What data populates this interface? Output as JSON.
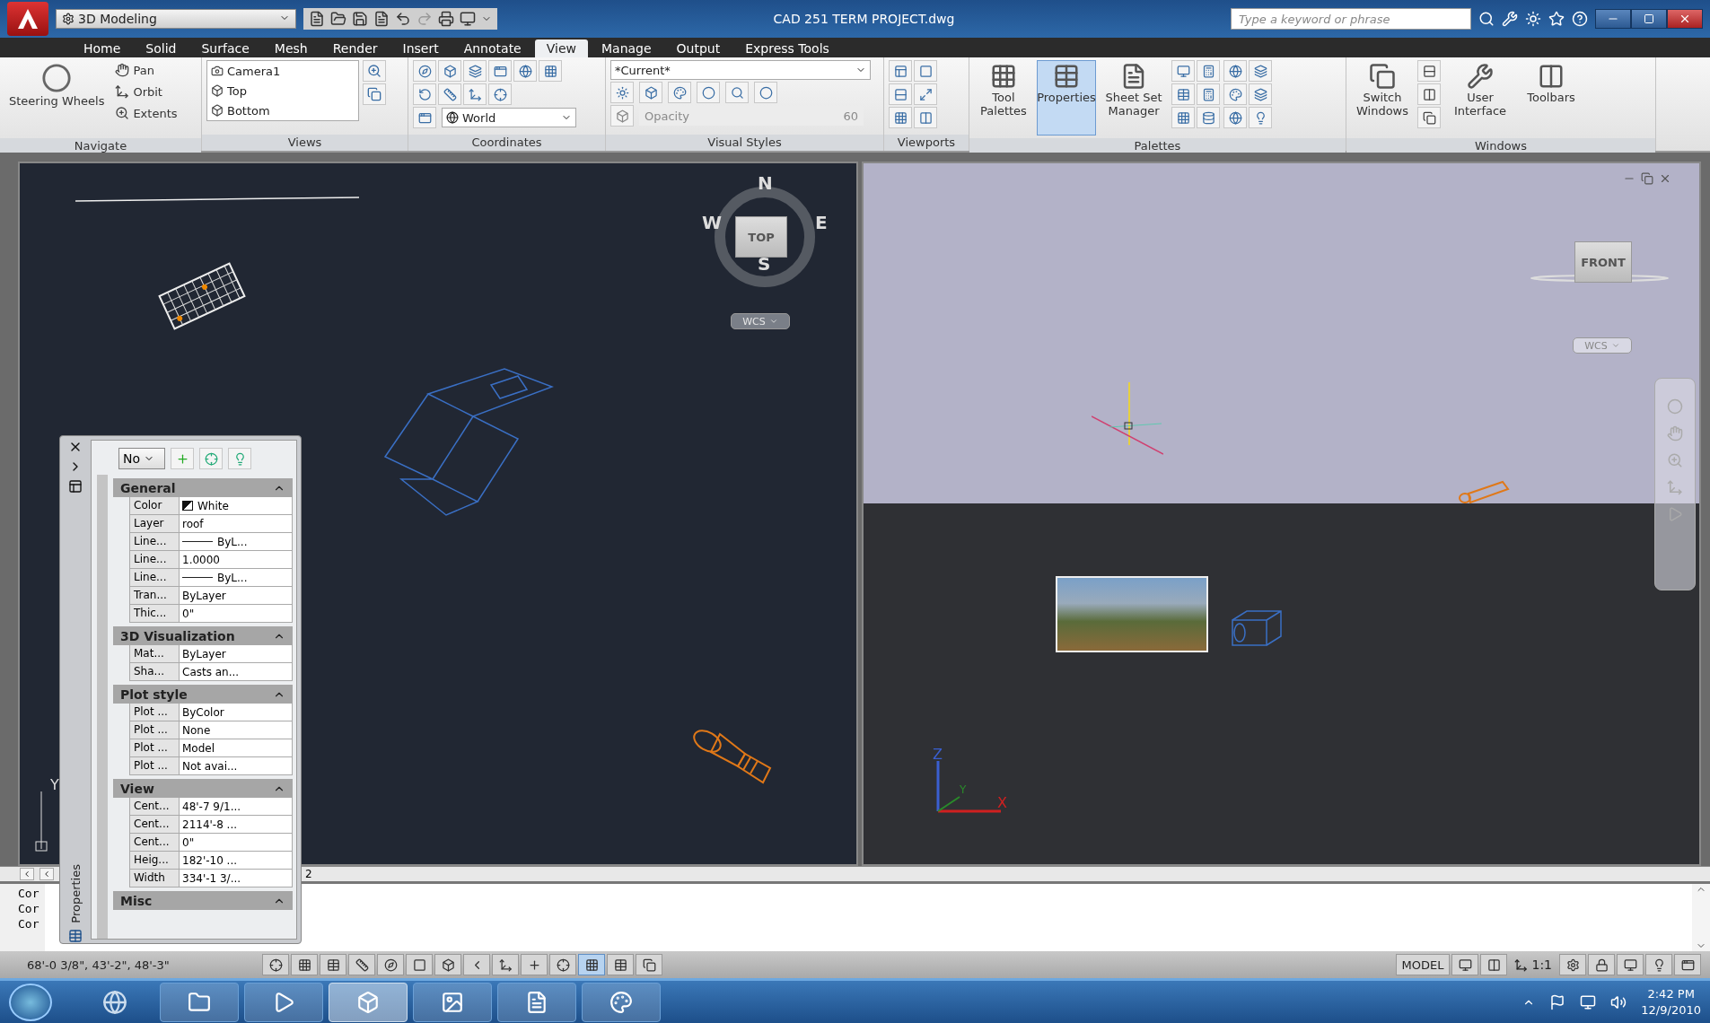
{
  "title_bar": {
    "workspace": "3D Modeling",
    "title": "CAD 251 TERM PROJECT.dwg",
    "search": {
      "placeholder": "Type a keyword or phrase"
    }
  },
  "ribbon_tabs": [
    {
      "label": "Home",
      "selected": false
    },
    {
      "label": "Solid",
      "selected": false
    },
    {
      "label": "Surface",
      "selected": false
    },
    {
      "label": "Mesh",
      "selected": false
    },
    {
      "label": "Render",
      "selected": false
    },
    {
      "label": "Insert",
      "selected": false
    },
    {
      "label": "Annotate",
      "selected": false
    },
    {
      "label": "View",
      "selected": true
    },
    {
      "label": "Manage",
      "selected": false
    },
    {
      "label": "Output",
      "selected": false
    },
    {
      "label": "Express Tools",
      "selected": false
    }
  ],
  "ribbon": {
    "navigate": {
      "title": "Navigate",
      "big": "Steering Wheels",
      "items": [
        "Pan",
        "Orbit",
        "Extents"
      ]
    },
    "views": {
      "title": "Views",
      "items": [
        "Camera1",
        "Top",
        "Bottom"
      ]
    },
    "coordinates": {
      "title": "Coordinates",
      "ucs": "World"
    },
    "visual_styles": {
      "title": "Visual Styles",
      "current": "*Current*",
      "opacity": {
        "label": "Opacity",
        "value": "60",
        "disabled": true
      }
    },
    "viewports": {
      "title": "Viewports"
    },
    "palettes": {
      "title": "Palettes",
      "buttons": [
        {
          "label": "Tool Palettes",
          "active": false
        },
        {
          "label": "Properties",
          "active": true
        },
        {
          "label": "Sheet Set Manager",
          "active": false
        }
      ]
    },
    "windows": {
      "title": "Windows",
      "buttons": [
        "Switch Windows",
        "User Interface",
        "Toolbars"
      ]
    }
  },
  "left_viewport": {
    "compass": [
      "N",
      "E",
      "S",
      "W"
    ],
    "cube_face": "TOP",
    "ucs_button": "WCS",
    "axis_label": "Y"
  },
  "right_viewport": {
    "cube_face": "FRONT",
    "ucs_button": "WCS",
    "axis_labels": [
      "X",
      "Y",
      "Z"
    ]
  },
  "properties_palette": {
    "title": "Properties",
    "selection": "No",
    "sections": [
      {
        "title": "General",
        "expanded": true,
        "rows": [
          {
            "label": "Color",
            "value": "White",
            "kind": "color"
          },
          {
            "label": "Layer",
            "value": "roof",
            "kind": "text"
          },
          {
            "label": "Line...",
            "value": "ByL...",
            "kind": "linetype"
          },
          {
            "label": "Line...",
            "value": "1.0000",
            "kind": "text"
          },
          {
            "label": "Line...",
            "value": "ByL...",
            "kind": "linetype"
          },
          {
            "label": "Tran...",
            "value": "ByLayer",
            "kind": "text"
          },
          {
            "label": "Thic...",
            "value": "0\"",
            "kind": "text"
          }
        ]
      },
      {
        "title": "3D Visualization",
        "expanded": true,
        "rows": [
          {
            "label": "Mat...",
            "value": "ByLayer",
            "kind": "text"
          },
          {
            "label": "Sha...",
            "value": "Casts an...",
            "kind": "text"
          }
        ]
      },
      {
        "title": "Plot style",
        "expanded": true,
        "rows": [
          {
            "label": "Plot ...",
            "value": "ByColor",
            "kind": "text"
          },
          {
            "label": "Plot ...",
            "value": "None",
            "kind": "text"
          },
          {
            "label": "Plot ...",
            "value": "Model",
            "kind": "text"
          },
          {
            "label": "Plot ...",
            "value": "Not avai...",
            "kind": "text"
          }
        ]
      },
      {
        "title": "View",
        "expanded": true,
        "rows": [
          {
            "label": "Cent...",
            "value": "48'-7 9/1...",
            "kind": "text"
          },
          {
            "label": "Cent...",
            "value": "2114'-8 ...",
            "kind": "text"
          },
          {
            "label": "Cent...",
            "value": "0\"",
            "kind": "text"
          },
          {
            "label": "Heig...",
            "value": "182'-10 ...",
            "kind": "text"
          },
          {
            "label": "Width",
            "value": "334'-1 3/...",
            "kind": "text"
          }
        ]
      },
      {
        "title": "Misc",
        "expanded": true
      }
    ]
  },
  "layout_tab": "2",
  "command_line": {
    "history": [
      "Cor",
      "Cor",
      "Cor"
    ]
  },
  "status_bar": {
    "coordinates": "68'-0 3/8\", 43'-2\", 48'-3\"",
    "toggles": [
      {
        "on": false
      },
      {
        "on": false
      },
      {
        "on": false
      },
      {
        "on": false
      },
      {
        "on": false
      },
      {
        "on": false
      },
      {
        "on": false
      },
      {
        "on": false
      },
      {
        "on": false
      },
      {
        "on": false
      },
      {
        "on": false
      },
      {
        "on": true
      },
      {
        "on": false
      },
      {
        "on": false
      }
    ],
    "space": "MODEL",
    "scale": "1:1"
  },
  "taskbar": {
    "apps": [
      {
        "active": false
      },
      {
        "active": false
      },
      {
        "active": true
      },
      {
        "active": false
      },
      {
        "active": false
      },
      {
        "active": false
      }
    ],
    "time": "2:42 PM",
    "date": "12/9/2010"
  }
}
